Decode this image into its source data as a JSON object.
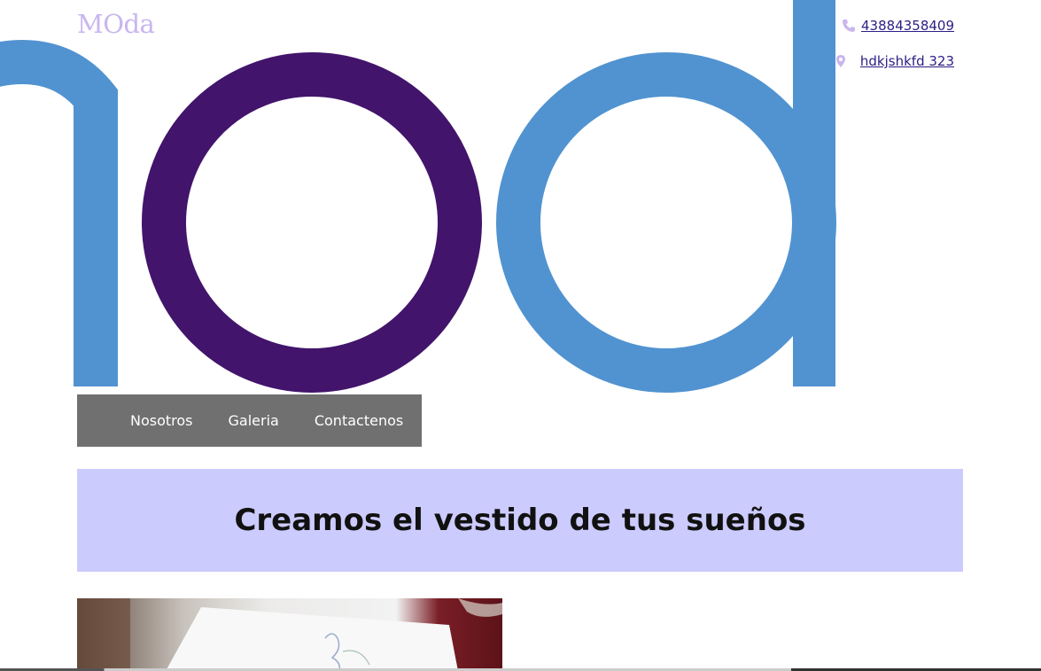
{
  "header": {
    "brand": "MOda",
    "hero_logo_icon": "mod-logo-graphic"
  },
  "contact": {
    "phone": "43884358409",
    "address": "hdkjshkfd 323",
    "phone_icon": "phone-icon",
    "location_icon": "location-pin-icon",
    "icon_color": "#c9b6ee",
    "link_color": "#2b1e84"
  },
  "nav": {
    "items": [
      {
        "label": "Nosotros"
      },
      {
        "label": "Galeria"
      },
      {
        "label": "Contactenos"
      }
    ],
    "background": "#707070"
  },
  "banner": {
    "title": "Creamos el vestido de tus sueños",
    "background": "#cccbfd"
  },
  "colors": {
    "logo_blue": "#5193d0",
    "logo_purple": "#42146b"
  }
}
